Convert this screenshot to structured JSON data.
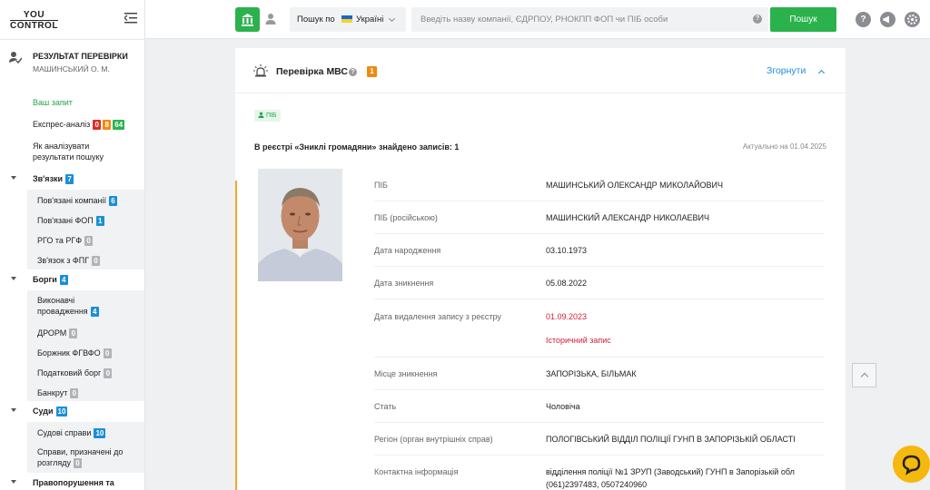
{
  "logo": {
    "line1": "YOU",
    "line2": "CONTROL"
  },
  "sidebar": {
    "result_title": "РЕЗУЛЬТАТ ПЕРЕВІРКИ",
    "result_name": "МАШИНСЬКИЙ О. М.",
    "your_request": "Ваш запит",
    "express": {
      "label": "Експрес-аналіз",
      "red": "0",
      "orange": "8",
      "green": "64"
    },
    "how_to": "Як аналізувати результати пошуку",
    "groups": [
      {
        "title": "Зв'язки",
        "count": "7",
        "items": [
          {
            "label": "Пов'язані компанії",
            "count": "6"
          },
          {
            "label": "Пов'язані ФОП",
            "count": "1"
          },
          {
            "label": "РГО та РГФ",
            "count": "0"
          },
          {
            "label": "Зв'язок з ФПГ",
            "count": "0"
          }
        ]
      },
      {
        "title": "Борги",
        "count": "4",
        "items": [
          {
            "label": "Виконавчі провадження",
            "count": "4"
          },
          {
            "label": "ДРОРМ",
            "count": "0"
          },
          {
            "label": "Боржник ФГВФО",
            "count": "0"
          },
          {
            "label": "Податковий борг",
            "count": "0"
          },
          {
            "label": "Банкрут",
            "count": "0"
          }
        ]
      },
      {
        "title": "Суди",
        "count": "10",
        "items": [
          {
            "label": "Судові справи",
            "count": "10"
          },
          {
            "label": "Справи, призначені до розгляду",
            "count": "0"
          }
        ]
      },
      {
        "title": "Правопорушення та"
      }
    ]
  },
  "topbar": {
    "search_by": "Пошук по",
    "country": "Україні",
    "search_placeholder": "Введіть назву компанії, ЄДРПОУ, РНОКПП ФОП чи ПІБ особи",
    "search_button": "Пошук",
    "help_small": "?",
    "help": "?"
  },
  "card": {
    "title": "Перевірка МВС",
    "count": "1",
    "collapse": "Згорнути",
    "tag": "ПІБ",
    "found_text": "В реєстрі «Зниклі громадяни» знайдено записів: 1",
    "actual": "Актуально на 01.04.2025",
    "rows": [
      {
        "key": "ПІБ",
        "value": "МАШИНСЬКИЙ ОЛЕКСАНДР МИКОЛАЙОВИЧ"
      },
      {
        "key": "ПІБ (російською)",
        "value": "МАШИНСКИЙ АЛЕКСАНДР НИКОЛАЕВИЧ"
      },
      {
        "key": "Дата народження",
        "value": "03.10.1973"
      },
      {
        "key": "Дата зникнення",
        "value": "05.08.2022"
      },
      {
        "key": "Дата видалення запису з реєстру",
        "value": "01.09.2023",
        "note": "Історичний запис"
      },
      {
        "key": "Місце зникнення",
        "value": "ЗАПОРІЗЬКА, БІЛЬМАК"
      },
      {
        "key": "Стать",
        "value": "Чоловіча"
      },
      {
        "key": "Регіон (орган внутрішніх справ)",
        "value": "ПОЛОГІВСЬКИЙ ВІДДІЛ ПОЛІЦІЇ ГУНП В ЗАПОРІЗЬКІЙ ОБЛАСТІ"
      },
      {
        "key": "Контактна інформація",
        "value": "відділення поліції №1 ЗРУП (Заводський) ГУНП в Запорізькій обл",
        "value2": "(061)2397483, 0507240960"
      }
    ]
  },
  "colors": {
    "green": "#2bb24c",
    "blue": "#1a8fd6",
    "orange": "#f08a12",
    "red": "#d0213a"
  }
}
